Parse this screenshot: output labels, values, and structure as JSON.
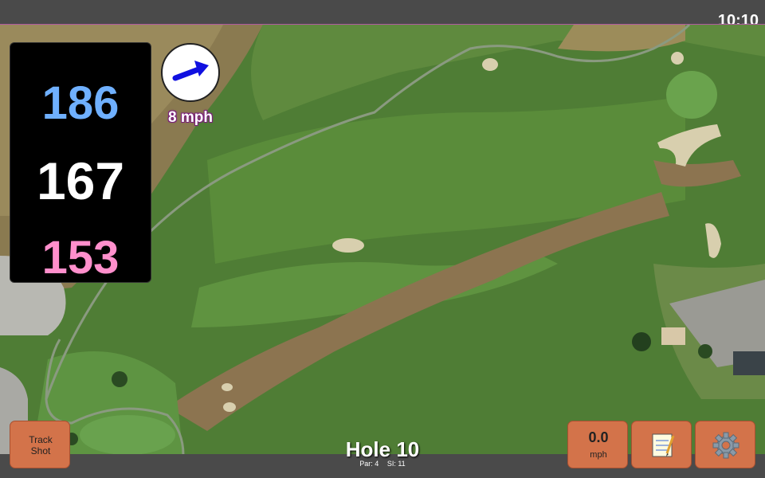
{
  "status": {
    "time": "10:10"
  },
  "distances": {
    "back": "186",
    "middle": "167",
    "front": "153"
  },
  "wind": {
    "speed_label": "8 mph",
    "icon": "wind-arrow-icon"
  },
  "buttons": {
    "track_shot": "Track Shot",
    "speed_value": "0.0",
    "speed_unit": "mph",
    "notes_icon": "notepad-icon",
    "settings_icon": "gear-icon"
  },
  "hole": {
    "title": "Hole 10",
    "par": "Par: 4",
    "si": "SI: 11"
  },
  "colors": {
    "back_distance": "#6fb0ff",
    "middle_distance": "#ffffff",
    "front_distance": "#ff8fcc",
    "button": "#d3734a"
  }
}
